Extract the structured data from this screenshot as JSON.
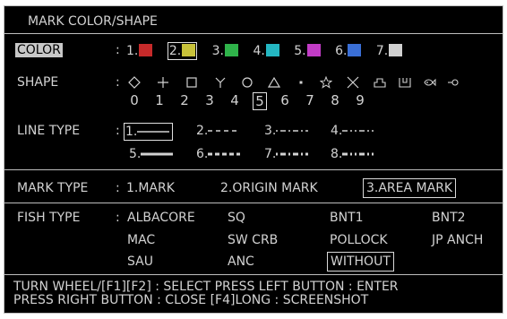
{
  "title": "MARK COLOR/SHAPE",
  "color": {
    "label": "COLOR",
    "sep": ":",
    "items": [
      {
        "num": "1.",
        "hex": "#c62a2a"
      },
      {
        "num": "2.",
        "hex": "#c8c23a"
      },
      {
        "num": "3.",
        "hex": "#2fb34a"
      },
      {
        "num": "4.",
        "hex": "#24b7c2"
      },
      {
        "num": "5.",
        "hex": "#c23cc6"
      },
      {
        "num": "6.",
        "hex": "#3a6fd6"
      },
      {
        "num": "7.",
        "hex": "#d0d0d0"
      }
    ],
    "selected_index": 1
  },
  "shape": {
    "label": "SHAPE",
    "sep": ":",
    "icons": [
      "diamond-icon",
      "plus-icon",
      "square-icon",
      "y-shape-icon",
      "circle-icon",
      "triangle-icon",
      "dot-icon",
      "star-icon",
      "x-icon",
      "house-icon",
      "pillbox-icon",
      "fish-icon",
      "small-circle-icon"
    ],
    "numbers": [
      "0",
      "1",
      "2",
      "3",
      "4",
      "5",
      "6",
      "7",
      "8",
      "9"
    ],
    "selected_number": "5"
  },
  "line_type": {
    "label": "LINE TYPE",
    "sep": ":",
    "items": [
      {
        "num": "1.",
        "style": "solid-thin"
      },
      {
        "num": "2.",
        "style": "dashed"
      },
      {
        "num": "3.",
        "style": "dash-dot"
      },
      {
        "num": "4.",
        "style": "dash-dot-dot"
      },
      {
        "num": "5.",
        "style": "solid-thick"
      },
      {
        "num": "6.",
        "style": "dashed-thick"
      },
      {
        "num": "7.",
        "style": "dash-dot-thick"
      },
      {
        "num": "8.",
        "style": "dash-dot-dot-thick"
      }
    ],
    "selected": "1."
  },
  "mark_type": {
    "label": "MARK TYPE",
    "sep": ":",
    "options": [
      "1.MARK",
      "2.ORIGIN MARK",
      "3.AREA MARK"
    ],
    "selected": "3.AREA MARK"
  },
  "fish_type": {
    "label": "FISH TYPE",
    "sep": ":",
    "options": [
      "ALBACORE",
      "SQ",
      "BNT1",
      "BNT2",
      "MAC",
      "SW CRB",
      "POLLOCK",
      "JP ANCH",
      "SAU",
      "ANC",
      "WITHOUT"
    ],
    "selected": "WITHOUT"
  },
  "footer": {
    "line1": "TURN WHEEL/[F1][F2] : SELECT   PRESS LEFT BUTTON : ENTER",
    "line2": "PRESS RIGHT BUTTON : CLOSE   [F4]LONG : SCREENSHOT"
  }
}
